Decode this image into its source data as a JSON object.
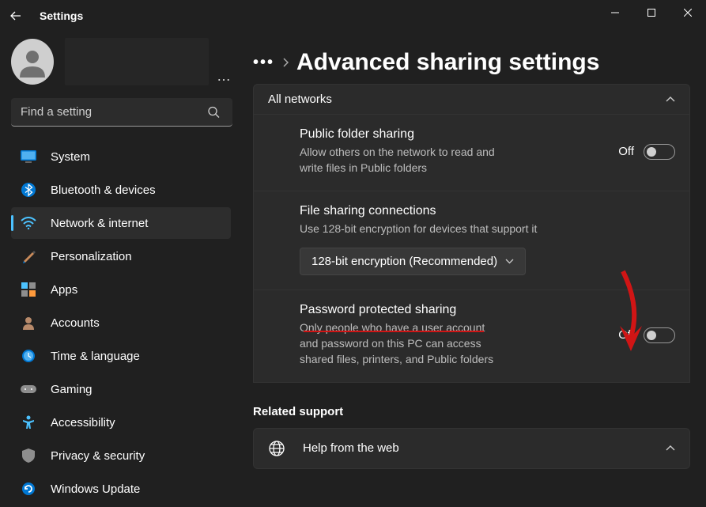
{
  "titlebar": {
    "app_name": "Settings"
  },
  "search": {
    "placeholder": "Find a setting"
  },
  "nav": {
    "system": "System",
    "bluetooth": "Bluetooth & devices",
    "network": "Network & internet",
    "personalization": "Personalization",
    "apps": "Apps",
    "accounts": "Accounts",
    "time": "Time & language",
    "gaming": "Gaming",
    "accessibility": "Accessibility",
    "privacy": "Privacy & security",
    "update": "Windows Update"
  },
  "breadcrumb": {
    "page_title": "Advanced sharing settings"
  },
  "group": {
    "header": "All networks"
  },
  "public_folder": {
    "title": "Public folder sharing",
    "sub": "Allow others on the network to read and write files in Public folders",
    "state": "Off"
  },
  "file_conn": {
    "title": "File sharing connections",
    "sub": "Use 128-bit encryption for devices that support it",
    "dropdown": "128-bit encryption (Recommended)"
  },
  "password": {
    "title": "Password protected sharing",
    "sub": "Only people who have a user account and password on this PC can access shared files, printers, and Public folders",
    "state": "Off"
  },
  "related": {
    "header": "Related support",
    "help": "Help from the web"
  }
}
